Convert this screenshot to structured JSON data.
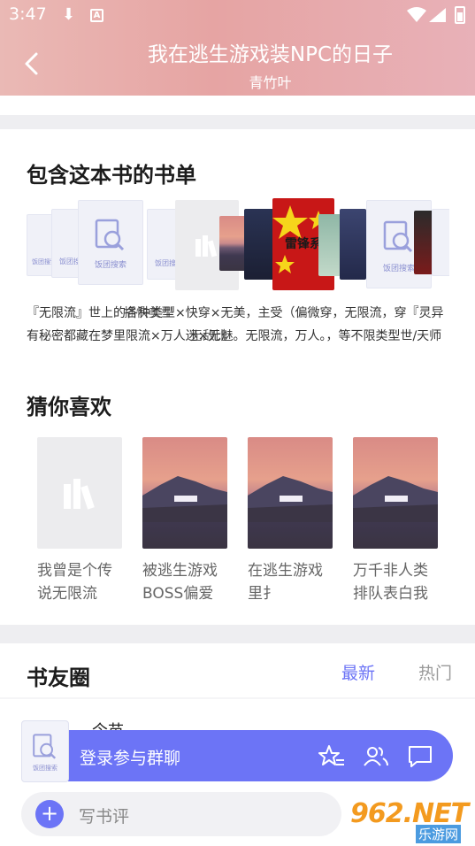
{
  "status": {
    "time": "3:47"
  },
  "header": {
    "title": "我在逃生游戏装NPC的日子",
    "author": "青竹叶"
  },
  "booklists": {
    "title": "包含这本书的书单",
    "covers": [
      {
        "label": "饭团搜索"
      },
      {
        "label": "饭团搜索"
      },
      {
        "label": "饭团搜索"
      },
      {
        "label": "饭团搜索"
      },
      {
        "label": "饭团搜索"
      }
    ],
    "desc_line1_a": "『无限流』世上的各种类型×快穿×无美，主受（偏微穿，无限流，穿『灵异",
    "desc_line1_b": "插快美型",
    "desc_line2_a": "有秘密都藏在梦里限流×万人迷×无魅。无限流，万人。，等不限类型世/天师",
    "desc_line2_b": "无敌比"
  },
  "recommend": {
    "title": "猜你喜欢",
    "items": [
      {
        "name": "我曾是个传说无限流"
      },
      {
        "name": "被逃生游戏BOSS偏爱"
      },
      {
        "name": "在逃生游戏里扌"
      },
      {
        "name": "万千非人类排队表白我"
      }
    ]
  },
  "circle": {
    "title": "书友圈",
    "tab_latest": "最新",
    "tab_hot": "热门",
    "peek": "今苗"
  },
  "chat": {
    "label": "登录参与群聊",
    "avatar_label": "饭团搜索"
  },
  "bottom": {
    "placeholder": "写书评"
  },
  "watermark": {
    "main": "962.NET",
    "sub": "乐游网"
  },
  "colors": {
    "accent": "#6c74f6",
    "header_pink": "#e6a4a3"
  }
}
